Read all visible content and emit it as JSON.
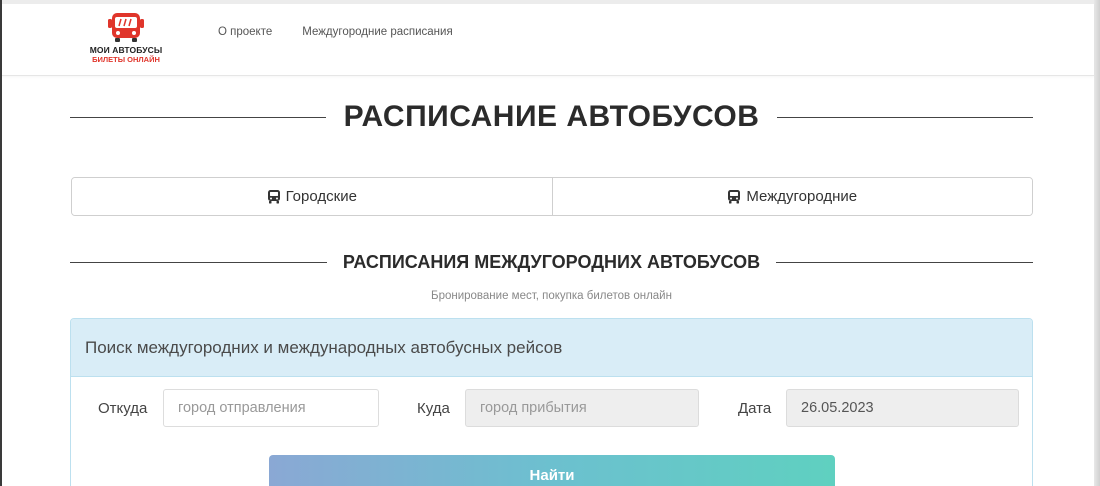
{
  "header": {
    "logo": {
      "line1": "МОИ АВТОБУСЫ",
      "line2": "БИЛЕТЫ ОНЛАЙН",
      "icon": "bus-logo-icon"
    },
    "nav": [
      {
        "label": "О проекте"
      },
      {
        "label": "Междугородние расписания"
      }
    ]
  },
  "page_title": "РАСПИСАНИЕ АВТОБУСОВ",
  "tabs": [
    {
      "label": "Городские",
      "icon": "bus-icon"
    },
    {
      "label": "Междугородние",
      "icon": "bus-icon"
    }
  ],
  "section": {
    "title": "РАСПИСАНИЯ МЕЖДУГОРОДНИХ АВТОБУСОВ",
    "subtitle": "Бронирование мест, покупка билетов онлайн"
  },
  "search": {
    "heading": "Поиск междугородних и международных автобусных рейсов",
    "from": {
      "label": "Откуда",
      "placeholder": "город отправления"
    },
    "to": {
      "label": "Куда",
      "placeholder": "город прибытия"
    },
    "date": {
      "label": "Дата",
      "value": "26.05.2023"
    },
    "submit_label": "Найти"
  },
  "colors": {
    "accent_red": "#e0352b",
    "panel_bg": "#d9edf7",
    "button_start": "#8aa8d4",
    "button_end": "#5fd0c0"
  }
}
